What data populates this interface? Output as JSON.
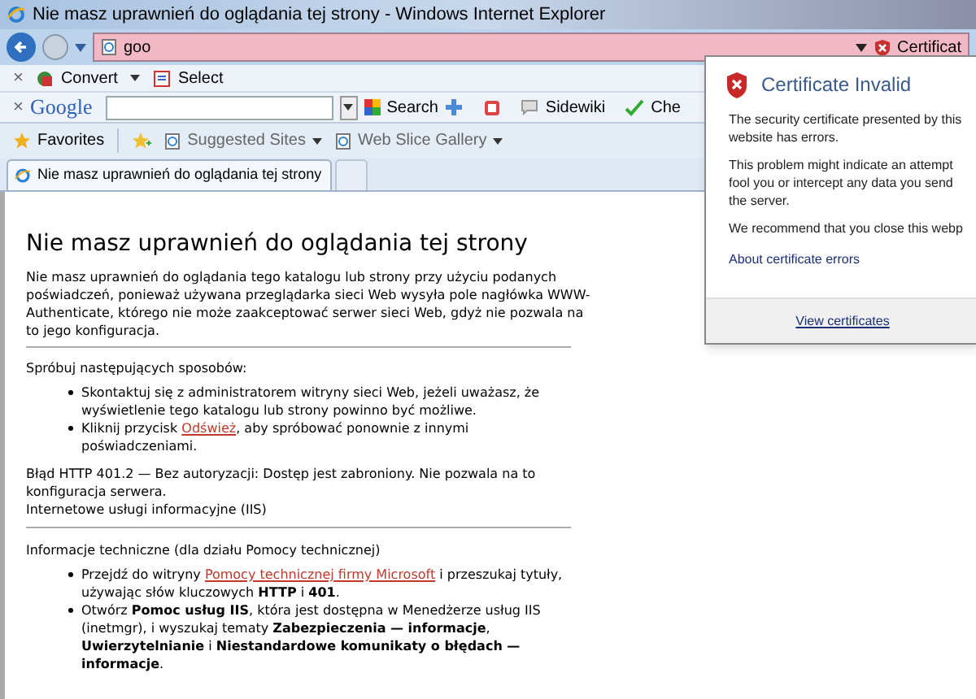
{
  "window": {
    "title": "Nie masz uprawnień do oglądania tej strony - Windows Internet Explorer"
  },
  "address_bar": {
    "value": "goo",
    "certificate_label": "Certificat"
  },
  "convert_toolbar": {
    "items": [
      {
        "kind": "close",
        "label": "×"
      },
      {
        "kind": "convert",
        "label": "Convert"
      },
      {
        "kind": "select",
        "label": "Select"
      }
    ]
  },
  "google_toolbar": {
    "close": "×",
    "logo": "Google",
    "search_button": "Search",
    "sidewiki": "Sidewiki",
    "check": "Che"
  },
  "favorites_bar": {
    "favorites": "Favorites",
    "items": [
      "Suggested Sites",
      "Web Slice Gallery"
    ]
  },
  "tabs": [
    {
      "label": "Nie masz uprawnień do oglądania tej strony",
      "selected": true
    },
    {
      "selected": false
    }
  ],
  "page": {
    "heading": "Nie masz uprawnień do oglądania tej strony",
    "intro": "Nie masz uprawnień do oglądania tego katalogu lub strony przy użyciu podanych poświadczeń, ponieważ używana przeglądarka sieci Web wysyła pole nagłówka WWW-Authenticate, którego nie może zaakceptować serwer sieci Web, gdyż nie pozwala na to jego konfiguracja.",
    "try_heading": "Spróbuj następujących sposobów:",
    "try_items": [
      {
        "text": "Skontaktuj się z administratorem witryny sieci Web, jeżeli uważasz, że wyświetlenie tego katalogu lub strony powinno być możliwe."
      },
      {
        "before": "Kliknij przycisk ",
        "link": "Odśwież",
        "after": ", aby spróbować ponownie z innymi poświadczeniami."
      }
    ],
    "error_lines": [
      "Błąd HTTP 401.2 — Bez autoryzacji: Dostęp jest zabroniony. Nie pozwala na to konfiguracja serwera.",
      "Internetowe usługi informacyjne (IIS)"
    ],
    "tech_heading": "Informacje techniczne (dla działu Pomocy technicznej)",
    "tech_items": [
      {
        "before": "Przejdź do witryny ",
        "link": "Pomocy technicznej firmy Microsoft",
        "after": " i przeszukaj tytuły, używając słów kluczowych **HTTP** i **401**."
      },
      {
        "text": "Otwórz **Pomoc usług IIS**, która jest dostępna w Menedżerze usług IIS (inetmgr), i wyszukaj tematy **Zabezpieczenia — informacje**, **Uwierzytelnianie** i **Niestandardowe komunikaty o błędach — informacje**."
      }
    ]
  },
  "certificate_popup": {
    "title": "Certificate Invalid",
    "paragraphs": [
      [
        "The security certificate presented by this",
        "website has errors."
      ],
      [
        "This problem might indicate an attempt",
        "fool you or intercept any data you send",
        "the server."
      ],
      [
        "We recommend that you close this webp"
      ]
    ],
    "link": "About certificate errors",
    "button": "View certificates"
  }
}
